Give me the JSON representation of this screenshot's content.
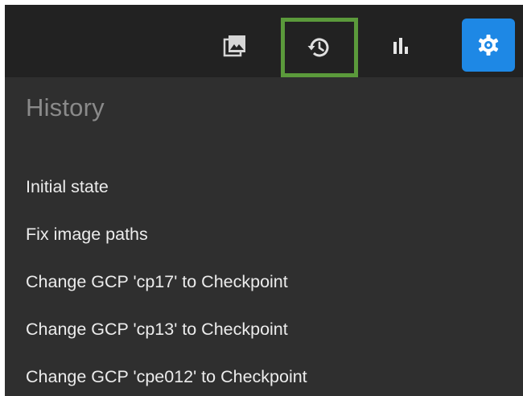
{
  "toolbar": {
    "buttons": [
      {
        "icon": "image-icon"
      },
      {
        "icon": "history-icon",
        "highlighted": true,
        "highlight_color": "#5b9a3b"
      },
      {
        "icon": "bar-chart-icon"
      },
      {
        "icon": "settings-gear-icon",
        "active": true,
        "accent_color": "#1e88e5"
      }
    ]
  },
  "panel": {
    "title": "History",
    "items": [
      "Initial state",
      "Fix image paths",
      "Change GCP 'cp17' to Checkpoint",
      "Change GCP 'cp13' to Checkpoint",
      "Change GCP 'cpe012' to Checkpoint"
    ]
  }
}
